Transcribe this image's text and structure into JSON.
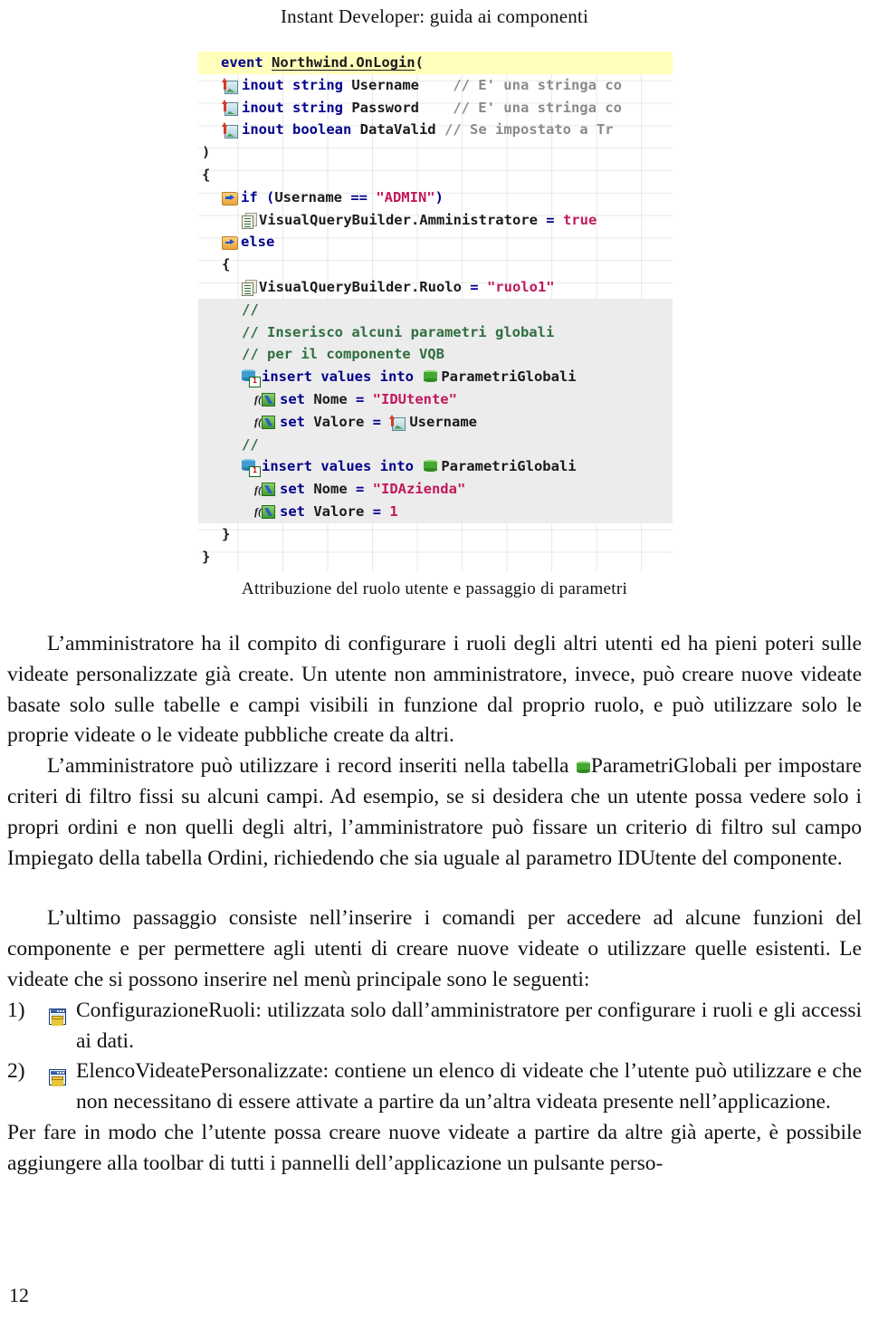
{
  "header": {
    "running_title": "Instant Developer: guida ai componenti"
  },
  "figure": {
    "caption": "Attribuzione del ruolo utente e passaggio di parametri",
    "code_lines": [
      {
        "indent": 0,
        "icon": "event-icon",
        "highlight": true,
        "tokens": [
          {
            "t": "event ",
            "c": "kw"
          },
          {
            "t": "Northwind.OnLogin",
            "c": "nm und"
          },
          {
            "t": "(",
            "c": "brc"
          }
        ]
      },
      {
        "indent": 1,
        "icon": "param-icon",
        "tokens": [
          {
            "t": "inout string ",
            "c": "kw"
          },
          {
            "t": "Username",
            "c": "nm"
          },
          {
            "t": "    ",
            "c": "nm"
          },
          {
            "t": "// E' una stringa co",
            "c": "cmt-gray"
          }
        ]
      },
      {
        "indent": 1,
        "icon": "param-icon",
        "tokens": [
          {
            "t": "inout string ",
            "c": "kw"
          },
          {
            "t": "Password",
            "c": "nm"
          },
          {
            "t": "    ",
            "c": "nm"
          },
          {
            "t": "// E' una stringa co",
            "c": "cmt-gray"
          }
        ]
      },
      {
        "indent": 1,
        "icon": "param-icon",
        "tokens": [
          {
            "t": "inout boolean ",
            "c": "kw"
          },
          {
            "t": "DataValid",
            "c": "nm"
          },
          {
            "t": " ",
            "c": "nm"
          },
          {
            "t": "// Se impostato a Tr",
            "c": "cmt-gray"
          }
        ]
      },
      {
        "indent": 0,
        "icon": "none",
        "tokens": [
          {
            "t": ")",
            "c": "brc"
          }
        ]
      },
      {
        "indent": 0,
        "icon": "none",
        "tokens": [
          {
            "t": "{",
            "c": "brc"
          }
        ]
      },
      {
        "indent": 1,
        "icon": "branch-icon",
        "tokens": [
          {
            "t": "if (",
            "c": "kw"
          },
          {
            "t": "Username",
            "c": "nm"
          },
          {
            "t": " == ",
            "c": "kw"
          },
          {
            "t": "\"ADMIN\"",
            "c": "str"
          },
          {
            "t": ")",
            "c": "kw"
          }
        ]
      },
      {
        "indent": 2,
        "icon": "assign-icon",
        "tokens": [
          {
            "t": "VisualQueryBuilder.Amministratore",
            "c": "nm"
          },
          {
            "t": " = ",
            "c": "kw"
          },
          {
            "t": "true",
            "c": "str"
          }
        ]
      },
      {
        "indent": 1,
        "icon": "branch-icon",
        "tokens": [
          {
            "t": "else",
            "c": "kw"
          }
        ]
      },
      {
        "indent": 1,
        "icon": "none",
        "tokens": [
          {
            "t": "{",
            "c": "brc"
          }
        ]
      },
      {
        "indent": 2,
        "icon": "assign-icon",
        "tokens": [
          {
            "t": "VisualQueryBuilder.Ruolo",
            "c": "nm"
          },
          {
            "t": " = ",
            "c": "kw"
          },
          {
            "t": "\"ruolo1\"",
            "c": "str"
          }
        ]
      },
      {
        "indent": 2,
        "icon": "none",
        "shade": true,
        "tokens": [
          {
            "t": "//",
            "c": "cmt"
          }
        ]
      },
      {
        "indent": 2,
        "icon": "none",
        "shade": true,
        "tokens": [
          {
            "t": "// Inserisco alcuni parametri globali",
            "c": "cmt"
          }
        ]
      },
      {
        "indent": 2,
        "icon": "none",
        "shade": true,
        "tokens": [
          {
            "t": "// per il componente VQB",
            "c": "cmt"
          }
        ]
      },
      {
        "indent": 2,
        "icon": "db-insert-icon",
        "shade": true,
        "tokens": [
          {
            "t": "insert values into ",
            "c": "kw"
          },
          {
            "t": "@DB@",
            "c": "icon"
          },
          {
            "t": "ParametriGlobali",
            "c": "nm"
          }
        ]
      },
      {
        "indent": 3,
        "icon": "fx-icon",
        "shade": true,
        "tokens": [
          {
            "t": "set ",
            "c": "kw"
          },
          {
            "t": "Nome",
            "c": "nm"
          },
          {
            "t": " = ",
            "c": "kw"
          },
          {
            "t": "\"IDUtente\"",
            "c": "str"
          }
        ]
      },
      {
        "indent": 3,
        "icon": "fx-icon",
        "shade": true,
        "tokens": [
          {
            "t": "set ",
            "c": "kw"
          },
          {
            "t": "Valore",
            "c": "nm"
          },
          {
            "t": " = ",
            "c": "kw"
          },
          {
            "t": "@PARAM@",
            "c": "icon"
          },
          {
            "t": "Username",
            "c": "nm"
          }
        ]
      },
      {
        "indent": 2,
        "icon": "none",
        "shade": true,
        "tokens": [
          {
            "t": "//",
            "c": "cmt"
          }
        ]
      },
      {
        "indent": 2,
        "icon": "db-insert-icon",
        "shade": true,
        "tokens": [
          {
            "t": "insert values into ",
            "c": "kw"
          },
          {
            "t": "@DB@",
            "c": "icon"
          },
          {
            "t": "ParametriGlobali",
            "c": "nm"
          }
        ]
      },
      {
        "indent": 3,
        "icon": "fx-icon",
        "shade": true,
        "tokens": [
          {
            "t": "set ",
            "c": "kw"
          },
          {
            "t": "Nome",
            "c": "nm"
          },
          {
            "t": " = ",
            "c": "kw"
          },
          {
            "t": "\"IDAzienda\"",
            "c": "str"
          }
        ]
      },
      {
        "indent": 3,
        "icon": "fx-icon",
        "shade": true,
        "tokens": [
          {
            "t": "set ",
            "c": "kw"
          },
          {
            "t": "Valore",
            "c": "nm"
          },
          {
            "t": " = ",
            "c": "kw"
          },
          {
            "t": "1",
            "c": "str"
          }
        ]
      },
      {
        "indent": 1,
        "icon": "none",
        "tokens": [
          {
            "t": "}",
            "c": "brc"
          }
        ]
      },
      {
        "indent": 0,
        "icon": "none",
        "tokens": [
          {
            "t": "}",
            "c": "brc"
          }
        ]
      }
    ]
  },
  "body": {
    "para1": "L’amministratore ha il compito di configurare i ruoli degli altri utenti ed ha pieni poteri sulle videate personalizzate già create. Un utente non amministratore, invece, può creare nuove videate basate solo sulle tabelle e campi visibili in funzione dal proprio ruolo, e può utilizzare solo le proprie videate o le videate pubbliche create da altri.",
    "para2_before_icon": "L’amministratore può utilizzare i record inseriti nella tabella ",
    "para2_table_name": "ParametriGlobali",
    "para2_after_icon": " per impostare criteri di filtro fissi su alcuni campi. Ad esempio, se si desidera che un utente possa vedere solo i propri ordini e non quelli degli altri, l’amministratore può fissare un criterio di filtro sul campo Impiegato della tabella Ordini, richiedendo che sia uguale al parametro IDUtente del componente.",
    "para3": "L’ultimo passaggio consiste nell’inserire i comandi per accedere ad alcune funzioni del componente e per permettere agli utenti di creare nuove videate o utilizzare quelle esistenti. Le videate che si possono inserire nel menù principale sono le seguenti:",
    "list": [
      {
        "number": "1)",
        "icon": "form-window-icon",
        "text": "ConfigurazioneRuoli: utilizzata solo dall’amministratore per configurare i ruoli e gli accessi ai dati."
      },
      {
        "number": "2)",
        "icon": "form-window-icon",
        "text": "ElencoVideatePersonalizzate: contiene un elenco di videate che l’utente può utilizzare e che non necessitano di essere attivate a partire da un’altra videata presente nell’applicazione."
      }
    ],
    "para4": "Per fare in modo che l’utente possa creare nuove videate a partire da altre già aperte, è possibile aggiungere alla toolbar di tutti i pannelli dell’applicazione un pulsante perso-"
  },
  "footer": {
    "page_number": "12"
  },
  "colors": {
    "keyword": "#00008c",
    "string": "#c2185b",
    "comment": "#2f6e3f",
    "comment_gray": "#8a8a8a",
    "highlight_row": "#ffffbb",
    "shaded_block": "#ececec",
    "db_green": "#46a832",
    "db_blue": "#3f9bd0"
  }
}
